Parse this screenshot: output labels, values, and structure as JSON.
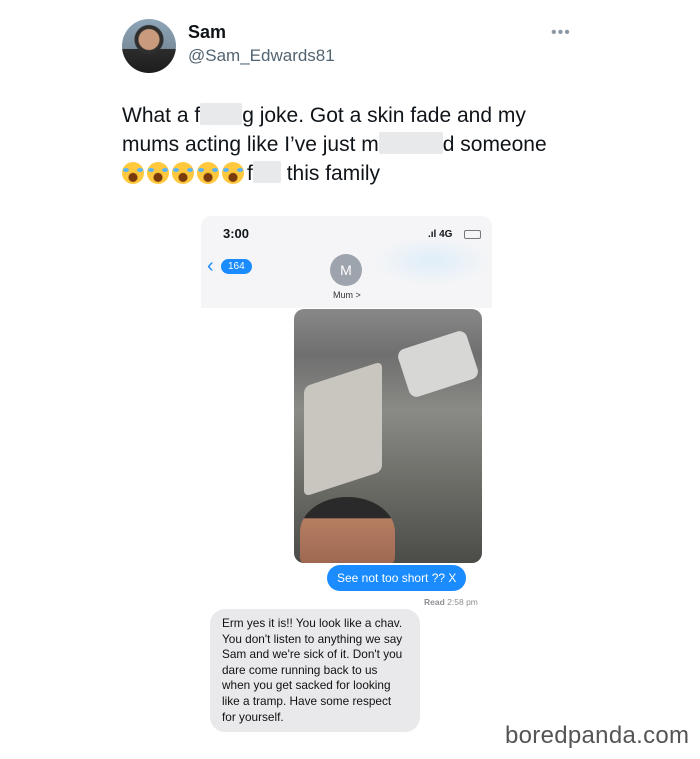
{
  "tweet": {
    "display_name": "Sam",
    "handle": "@Sam_Edwards81",
    "line1_a": "What a f",
    "line1_b": "g joke. Got a skin fade and my",
    "line2_a": "mums acting like I’ve just m",
    "line2_b": "d someone",
    "line3_a": "f",
    "line3_b": "this family",
    "more_glyph": "•••"
  },
  "phone": {
    "time": "3:00",
    "signal": "4G",
    "back_badge": "164",
    "contact_initial": "M",
    "contact_name": "Mum >"
  },
  "messages": {
    "sent": "See not too short ?? X",
    "read_label": "Read",
    "read_time": "2:58 pm",
    "received": "Erm yes it is!! You look like a chav. You don't listen to anything we say Sam and we're sick of it. Don't you dare come running back to us when you get sacked for looking like a tramp. Have some respect for yourself."
  },
  "watermark": "boredpanda.com",
  "colors": {
    "imessage_blue": "#1a8cff",
    "bubble_gray": "#e9e9eb"
  }
}
